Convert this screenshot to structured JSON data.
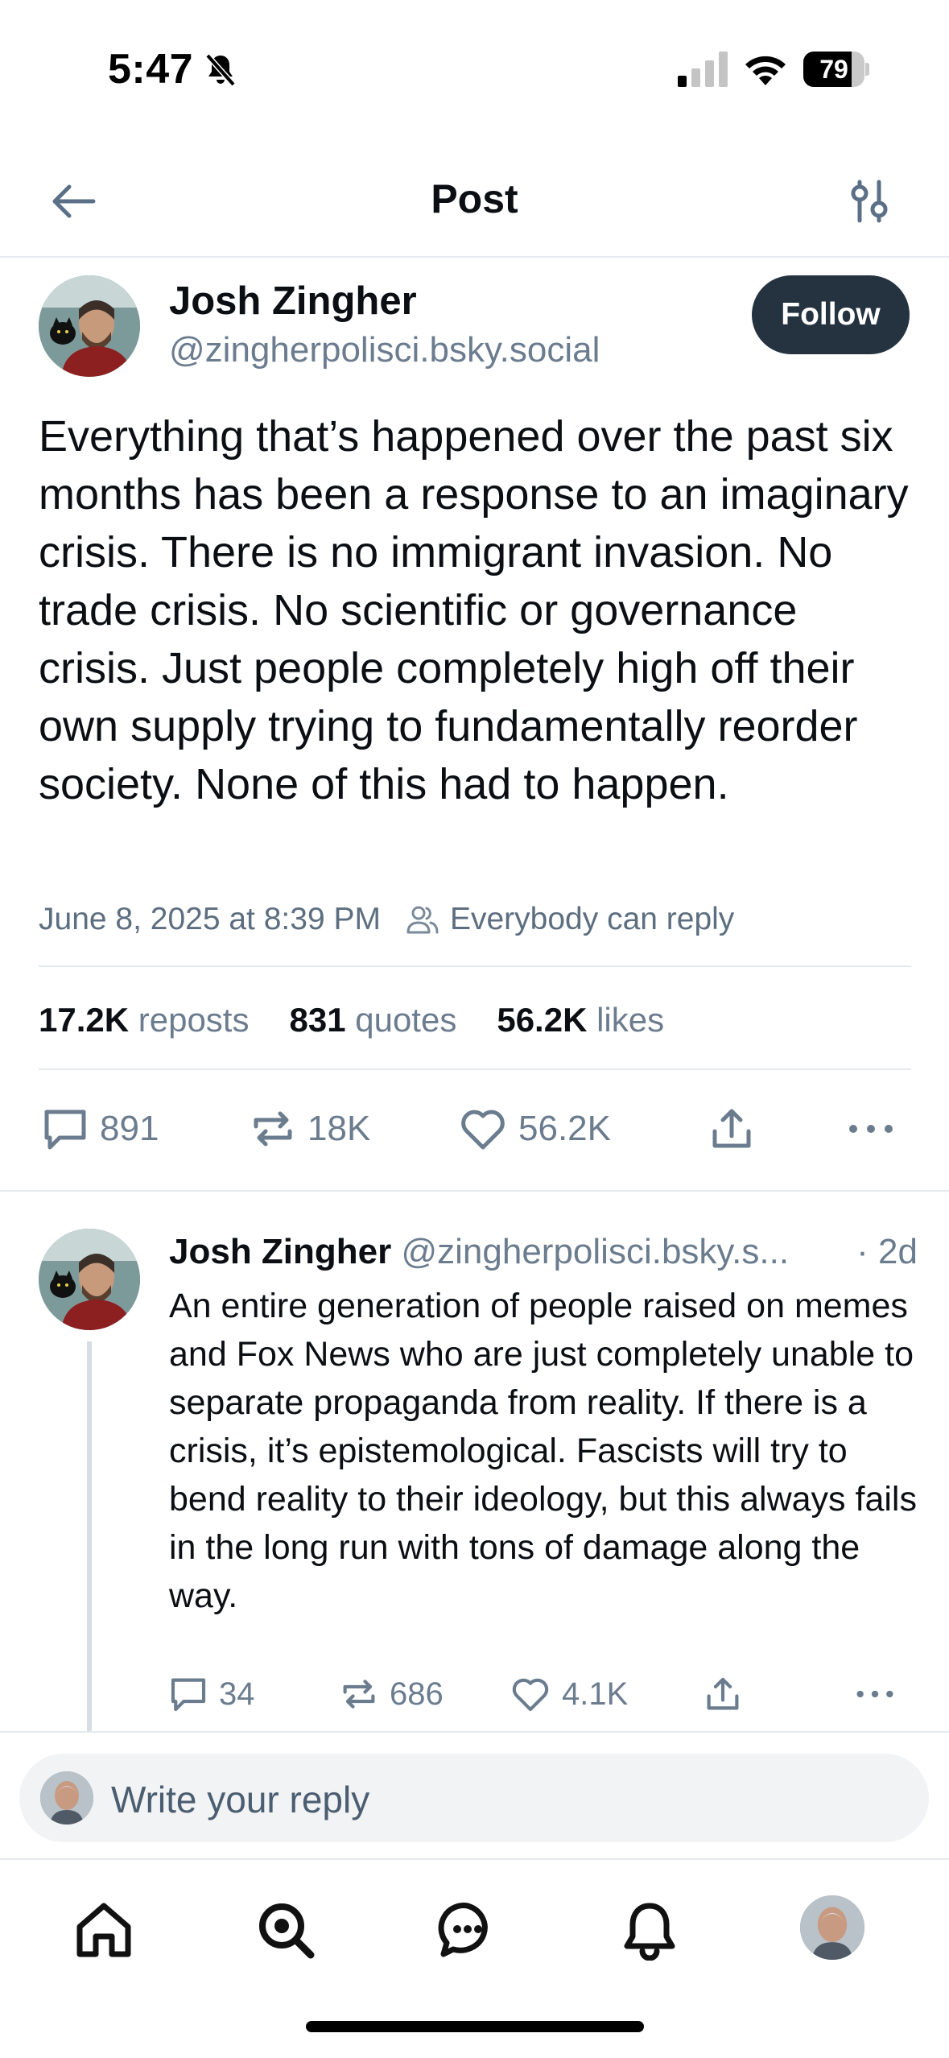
{
  "status_bar": {
    "time": "5:47",
    "battery": "79",
    "battery_level": 0.79,
    "icons": [
      "bell-slash-icon",
      "cellular-signal-icon",
      "wifi-icon",
      "battery-icon"
    ]
  },
  "header": {
    "title": "Post",
    "back_icon": "arrow-left-icon",
    "settings_icon": "sliders-icon"
  },
  "post": {
    "author_name": "Josh Zingher",
    "author_handle": "@zingherpolisci.bsky.social",
    "follow_label": "Follow",
    "text": "Everything that’s happened over the past six months has been a response to an imaginary crisis. There is no immigrant invasion. No trade crisis. No scientific or governance crisis. Just people completely high off their own supply trying to fundamentally reorder society. None of this had to happen.",
    "date": "June 8, 2025 at 8:39 PM",
    "reply_setting": "Everybody can reply",
    "stats": {
      "reposts_count": "17.2K",
      "reposts_label": "reposts",
      "quotes_count": "831",
      "quotes_label": "quotes",
      "likes_count": "56.2K",
      "likes_label": "likes"
    },
    "actions": {
      "replies": "891",
      "reposts": "18K",
      "likes": "56.2K"
    }
  },
  "reply": {
    "author_name": "Josh Zingher",
    "author_handle": "@zingherpolisci.bsky.s...",
    "time": "· 2d",
    "text": "An entire generation of people raised on memes and Fox News who are just completely unable to separate propaganda from reality. If there is a crisis, it’s epistemological. Fascists will try to bend reality to their ideology, but this always fails in the long run with tons of damage along the way.",
    "actions": {
      "replies": "34",
      "reposts": "686",
      "likes": "4.1K"
    }
  },
  "composer": {
    "placeholder": "Write your reply"
  },
  "tab_bar": {
    "tabs": [
      "home-icon",
      "search-icon",
      "chat-icon",
      "bell-icon",
      "profile-avatar"
    ]
  }
}
